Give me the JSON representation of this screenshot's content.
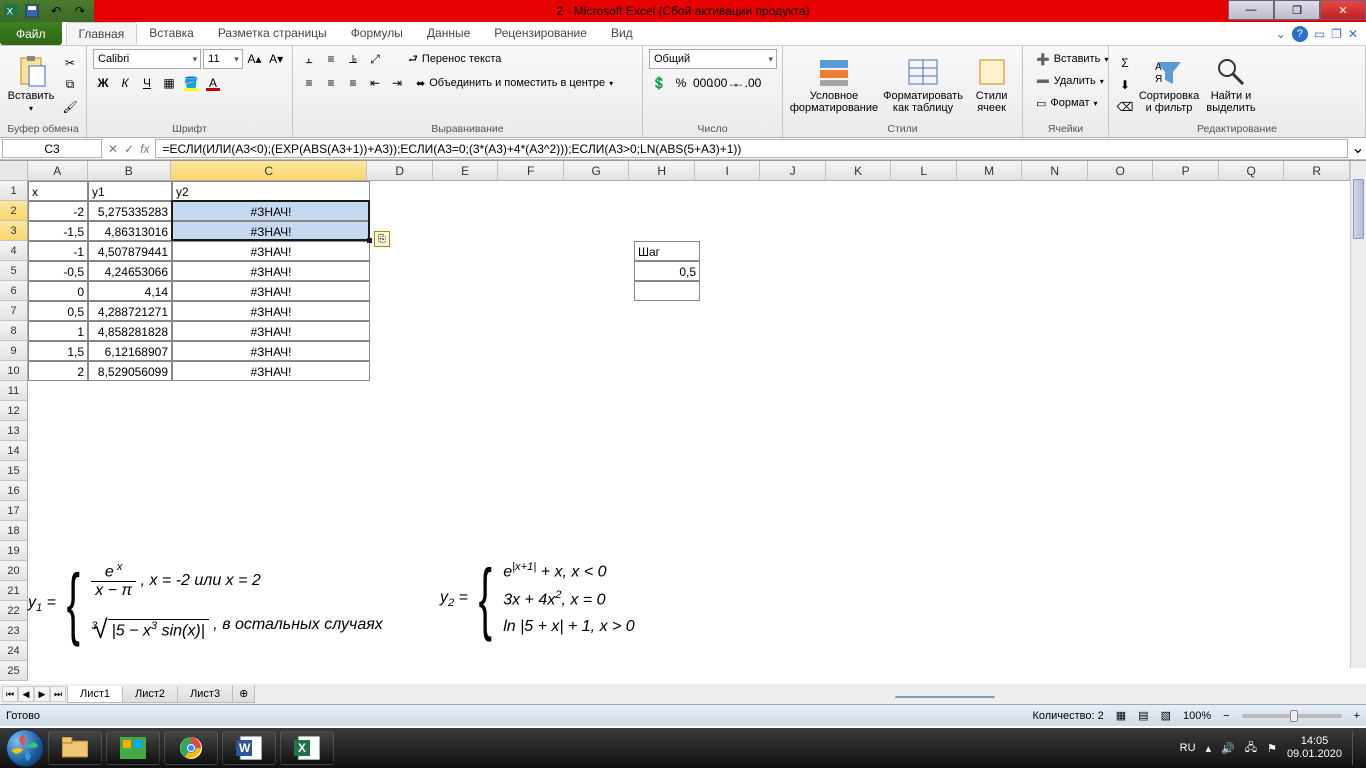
{
  "title": "2 - Microsoft Excel (Сбой активации продукта)",
  "tabs": {
    "file": "Файл",
    "items": [
      "Главная",
      "Вставка",
      "Разметка страницы",
      "Формулы",
      "Данные",
      "Рецензирование",
      "Вид"
    ],
    "active": 0
  },
  "ribbon": {
    "clipboard": {
      "paste": "Вставить",
      "label": "Буфер обмена"
    },
    "font": {
      "family": "Calibri",
      "size": "11",
      "bold": "Ж",
      "italic": "К",
      "underline": "Ч",
      "label": "Шрифт"
    },
    "align": {
      "wrap": "Перенос текста",
      "merge": "Объединить и поместить в центре",
      "label": "Выравнивание"
    },
    "number": {
      "format": "Общий",
      "label": "Число"
    },
    "styles": {
      "cond": "Условное форматирование",
      "table": "Форматировать как таблицу",
      "cell": "Стили ячеек",
      "label": "Стили"
    },
    "cells": {
      "insert": "Вставить",
      "delete": "Удалить",
      "format": "Формат",
      "label": "Ячейки"
    },
    "editing": {
      "sort": "Сортировка и фильтр",
      "find": "Найти и выделить",
      "label": "Редактирование"
    }
  },
  "namebox": "C3",
  "formula": "=ЕСЛИ(ИЛИ(A3<0);(EXP(ABS(A3+1))+A3));ЕСЛИ(A3=0;(3*(A3)+4*(A3^2)));ЕСЛИ(A3>0;LN(ABS(5+A3)+1))",
  "columns": [
    "A",
    "B",
    "C",
    "D",
    "E",
    "F",
    "G",
    "H",
    "I",
    "J",
    "K",
    "L",
    "M",
    "N",
    "O",
    "P",
    "Q",
    "R"
  ],
  "col_widths": {
    "A": 60,
    "B": 84,
    "C": 198,
    "default": 66
  },
  "rows_visible": 25,
  "headers": {
    "x": "x",
    "y1": "y1",
    "y2": "y2"
  },
  "data_rows": [
    {
      "x": "-2",
      "y1": "5,275335283",
      "y2": "#ЗНАЧ!"
    },
    {
      "x": "-1,5",
      "y1": "4,86313016",
      "y2": "#ЗНАЧ!"
    },
    {
      "x": "-1",
      "y1": "4,507879441",
      "y2": "#ЗНАЧ!"
    },
    {
      "x": "-0,5",
      "y1": "4,24653066",
      "y2": "#ЗНАЧ!"
    },
    {
      "x": "0",
      "y1": "4,14",
      "y2": "#ЗНАЧ!"
    },
    {
      "x": "0,5",
      "y1": "4,288721271",
      "y2": "#ЗНАЧ!"
    },
    {
      "x": "1",
      "y1": "4,858281828",
      "y2": "#ЗНАЧ!"
    },
    {
      "x": "1,5",
      "y1": "6,12168907",
      "y2": "#ЗНАЧ!"
    },
    {
      "x": "2",
      "y1": "8,529056099",
      "y2": "#ЗНАЧ!"
    }
  ],
  "step": {
    "label": "Шаг",
    "value": "0,5"
  },
  "math1": {
    "lhs": "y",
    "sub": "1",
    "case1_note": ", x = -2 или x = 2",
    "case2_note": ", в остальных  случаях"
  },
  "math2": {
    "lhs": "y",
    "sub": "2",
    "c1": ", x  <  0",
    "c2": ", x  =  0",
    "c3": ", x  >  0"
  },
  "sheets": [
    "Лист1",
    "Лист2",
    "Лист3"
  ],
  "status": {
    "ready": "Готово",
    "count_label": "Количество:",
    "count": "2",
    "zoom": "100%"
  },
  "taskbar": {
    "lang": "RU",
    "time": "14:05",
    "date": "09.01.2020"
  }
}
